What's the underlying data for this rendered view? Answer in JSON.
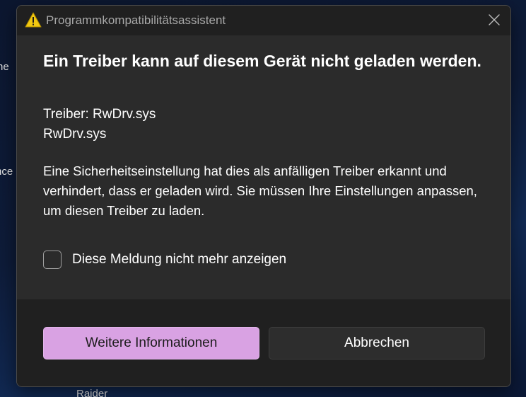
{
  "background": {
    "snippet_1": "ne",
    "snippet_2": "nce",
    "snippet_3": "Raider"
  },
  "dialog": {
    "title": "Programmkompatibilitätsassistent",
    "title_icon": "warning-icon",
    "close_icon": "close-icon",
    "heading": "Ein Treiber kann auf diesem Gerät nicht geladen werden.",
    "driver_line_1": "Treiber: RwDrv.sys",
    "driver_line_2": "RwDrv.sys",
    "description": "Eine Sicherheitseinstellung hat dies als anfälligen Treiber erkannt und verhindert, dass er geladen wird. Sie müssen Ihre Einstellungen anpassen, um diesen Treiber zu laden.",
    "checkbox_label": "Diese Meldung nicht mehr anzeigen",
    "checkbox_checked": false,
    "primary_button": "Weitere Informationen",
    "secondary_button": "Abbrechen"
  },
  "colors": {
    "dialog_body": "#2b2b2b",
    "dialog_chrome": "#202020",
    "accent": "#d9a2e3",
    "warning_yellow": "#f2c811"
  }
}
